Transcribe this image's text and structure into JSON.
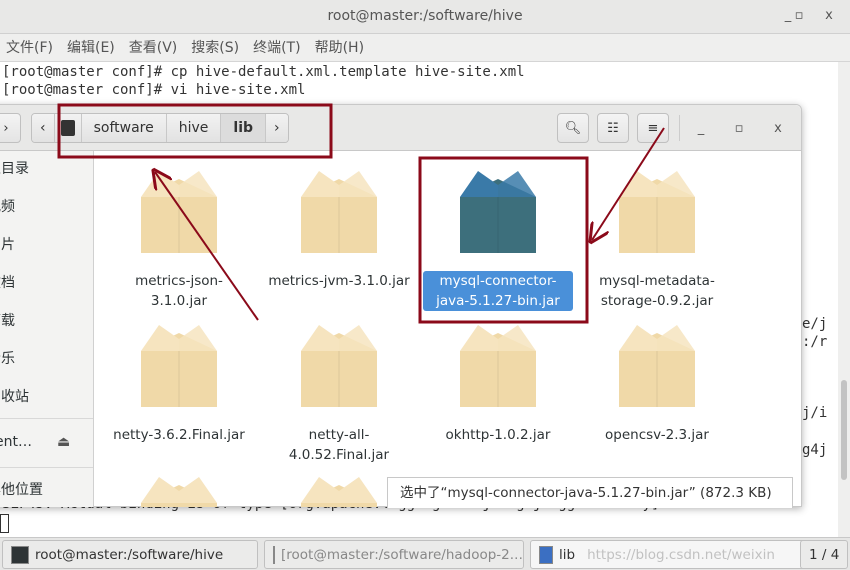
{
  "terminal": {
    "title": "root@master:/software/hive",
    "menu": [
      "文件(F)",
      "编辑(E)",
      "查看(V)",
      "搜索(S)",
      "终端(T)",
      "帮助(H)"
    ],
    "lines": [
      "[root@master conf]# cp hive-default.xml.template hive-site.xml",
      "[root@master conf]# vi hive-site.xml"
    ],
    "right_fragments": [
      "e/j",
      ":/r",
      "j/i",
      "g4j"
    ],
    "bottom_line": "SLF4J: Actual binding is of type [org.apache.logging.slf4j.Log4jLoggerFactory]"
  },
  "file_manager": {
    "breadcrumbs": [
      "software",
      "hive",
      "lib"
    ],
    "sidebar": [
      "主目录",
      "视频",
      "图片",
      "文档",
      "下载",
      "音乐",
      "回收站",
      "ent…",
      "其他位置"
    ],
    "files": [
      {
        "name": "metrics-json-3.1.0.jar",
        "selected": false
      },
      {
        "name": "metrics-jvm-3.1.0.jar",
        "selected": false
      },
      {
        "name": "mysql-connector-java-5.1.27-bin.jar",
        "selected": true
      },
      {
        "name": "mysql-metadata-storage-0.9.2.jar",
        "selected": false
      },
      {
        "name": "netty-3.6.2.Final.jar",
        "selected": false
      },
      {
        "name": "netty-all-4.0.52.Final.jar",
        "selected": false
      },
      {
        "name": "okhttp-1.0.2.jar",
        "selected": false
      },
      {
        "name": "opencsv-2.3.jar",
        "selected": false
      }
    ],
    "status": "选中了“mysql-connector-java-5.1.27-bin.jar” (872.3 KB)"
  },
  "taskbar": {
    "tasks": [
      "root@master:/software/hive",
      "[root@master:/software/hadoop-2.…",
      "lib"
    ],
    "watermark": "https://blog.csdn.net/weixin",
    "workspace": "1 / 4"
  },
  "colors": {
    "annotation": "#8b0a1a",
    "selection": "#4a90d9"
  }
}
